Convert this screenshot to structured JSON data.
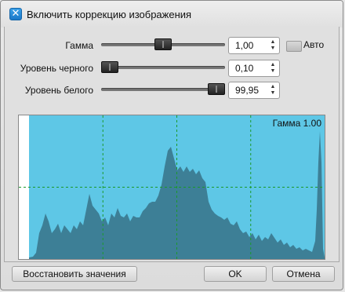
{
  "title": {
    "checkbox_checked": true,
    "label": "Включить коррекцию изображения"
  },
  "controls": {
    "gamma": {
      "label": "Гамма",
      "value": "1,00",
      "slider_fraction": 0.5
    },
    "black": {
      "label": "Уровень черного",
      "value": "0,10",
      "slider_fraction": 0.0
    },
    "white": {
      "label": "Уровень белого",
      "value": "99,95",
      "slider_fraction": 1.0
    },
    "auto": {
      "label": "Авто",
      "checked": false
    }
  },
  "histogram": {
    "label": "Гамма 1.00",
    "fill_color": "#5ec7e6",
    "histogram_color": "#3d7f96",
    "grid_color": "#1a9a2a",
    "black_point": 0.0,
    "white_point": 1.0
  },
  "buttons": {
    "reset": "Восстановить значения",
    "ok": "OK",
    "cancel": "Отмена"
  },
  "icons": {
    "checkbox": "checkmark-icon",
    "spinner": "spinner-arrows-icon"
  }
}
